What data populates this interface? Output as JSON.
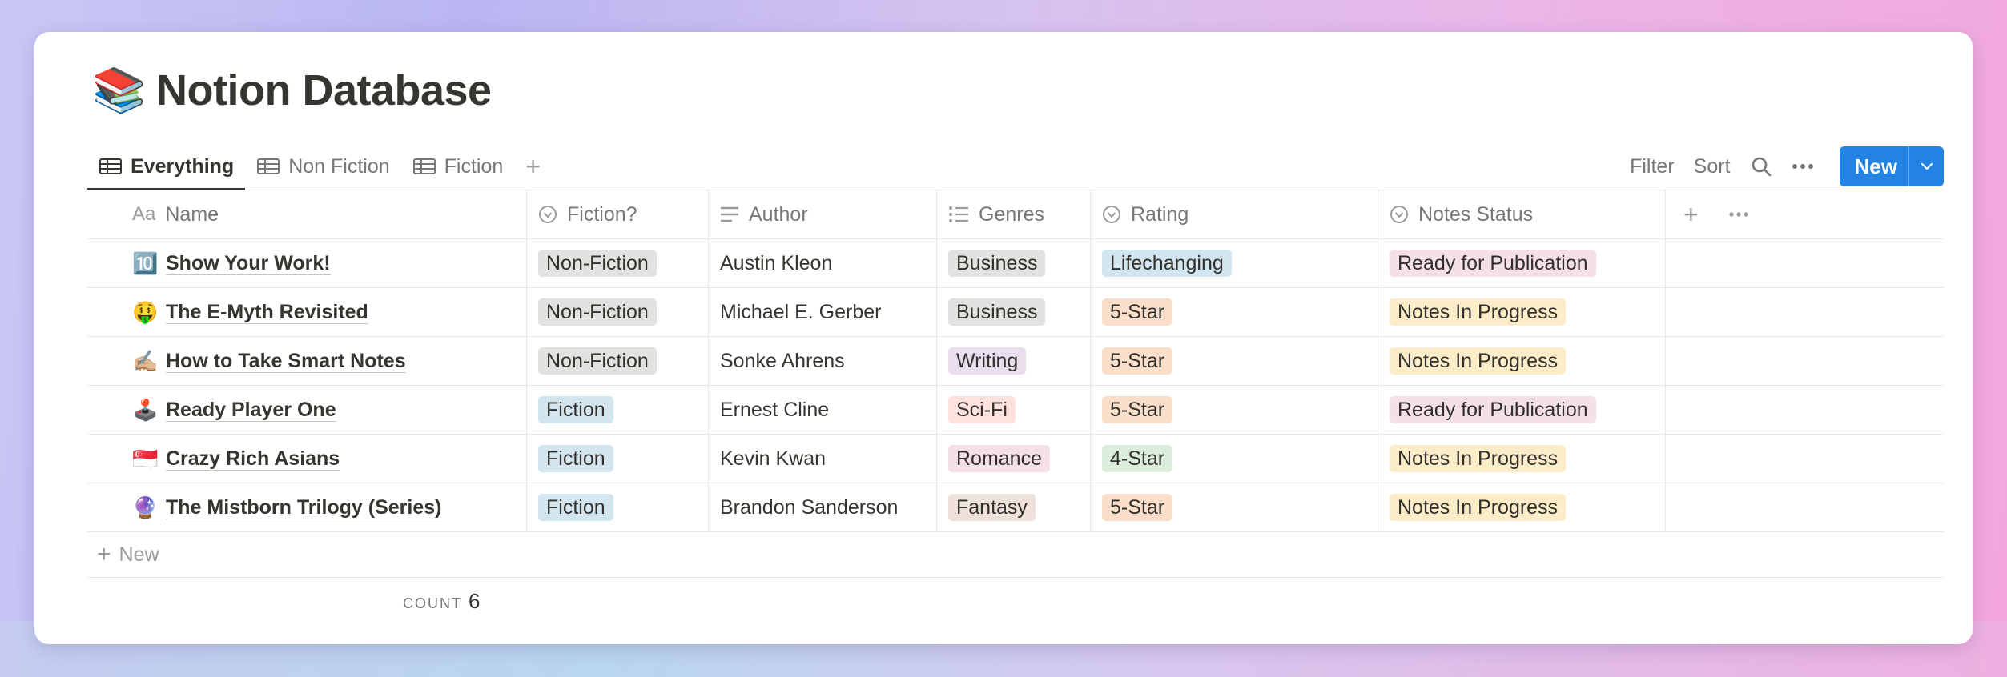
{
  "page": {
    "icon": "📚",
    "title": "Notion Database"
  },
  "tabs": [
    {
      "label": "Everything",
      "icon": "table-icon",
      "active": true
    },
    {
      "label": "Non Fiction",
      "icon": "table-icon",
      "active": false
    },
    {
      "label": "Fiction",
      "icon": "table-icon",
      "active": false
    }
  ],
  "toolbar": {
    "filter_label": "Filter",
    "sort_label": "Sort",
    "new_label": "New",
    "icons": [
      "search-icon",
      "more-icon",
      "chevron-down-icon"
    ],
    "accent": "#2383e2"
  },
  "columns": [
    {
      "label": "Name",
      "icon": "Aa"
    },
    {
      "label": "Fiction?",
      "icon": "select-icon"
    },
    {
      "label": "Author",
      "icon": "text-icon"
    },
    {
      "label": "Genres",
      "icon": "multi-select-icon"
    },
    {
      "label": "Rating",
      "icon": "select-icon"
    },
    {
      "label": "Notes Status",
      "icon": "select-icon"
    }
  ],
  "rows": [
    {
      "emoji": "🔟",
      "name": "Show Your Work!",
      "fiction": "Non-Fiction",
      "author": "Austin Kleon",
      "genre": "Business",
      "rating": "Lifechanging",
      "notes": "Ready for Publication"
    },
    {
      "emoji": "🤑",
      "name": "The E-Myth Revisited",
      "fiction": "Non-Fiction",
      "author": "Michael E. Gerber",
      "genre": "Business",
      "rating": "5-Star",
      "notes": "Notes In Progress"
    },
    {
      "emoji": "✍🏼",
      "name": "How to Take Smart Notes",
      "fiction": "Non-Fiction",
      "author": "Sonke Ahrens",
      "genre": "Writing",
      "rating": "5-Star",
      "notes": "Notes In Progress"
    },
    {
      "emoji": "🕹️",
      "name": "Ready Player One",
      "fiction": "Fiction",
      "author": "Ernest Cline",
      "genre": "Sci-Fi",
      "rating": "5-Star",
      "notes": "Ready for Publication"
    },
    {
      "emoji": "🇸🇬",
      "name": "Crazy Rich Asians",
      "fiction": "Fiction",
      "author": "Kevin Kwan",
      "genre": "Romance",
      "rating": "4-Star",
      "notes": "Notes In Progress"
    },
    {
      "emoji": "🔮",
      "name": "The Mistborn Trilogy (Series)",
      "fiction": "Fiction",
      "author": "Brandon Sanderson",
      "genre": "Fantasy",
      "rating": "5-Star",
      "notes": "Notes In Progress"
    }
  ],
  "tag_colors": {
    "Non-Fiction": "#e3e2e0",
    "Fiction": "#d3e5ef",
    "Business": "#e3e2e0",
    "Writing": "#e8deee",
    "Sci-Fi": "#ffe2dd",
    "Romance": "#f5e0e9",
    "Fantasy": "#eee0da",
    "Lifechanging": "#d3e5ef",
    "5-Star": "#fadec9",
    "4-Star": "#dbeddb",
    "Ready for Publication": "#f5e0e9",
    "Notes In Progress": "#fdecc8"
  },
  "footer": {
    "new_row_label": "New",
    "count_label": "COUNT",
    "count_value": "6"
  }
}
